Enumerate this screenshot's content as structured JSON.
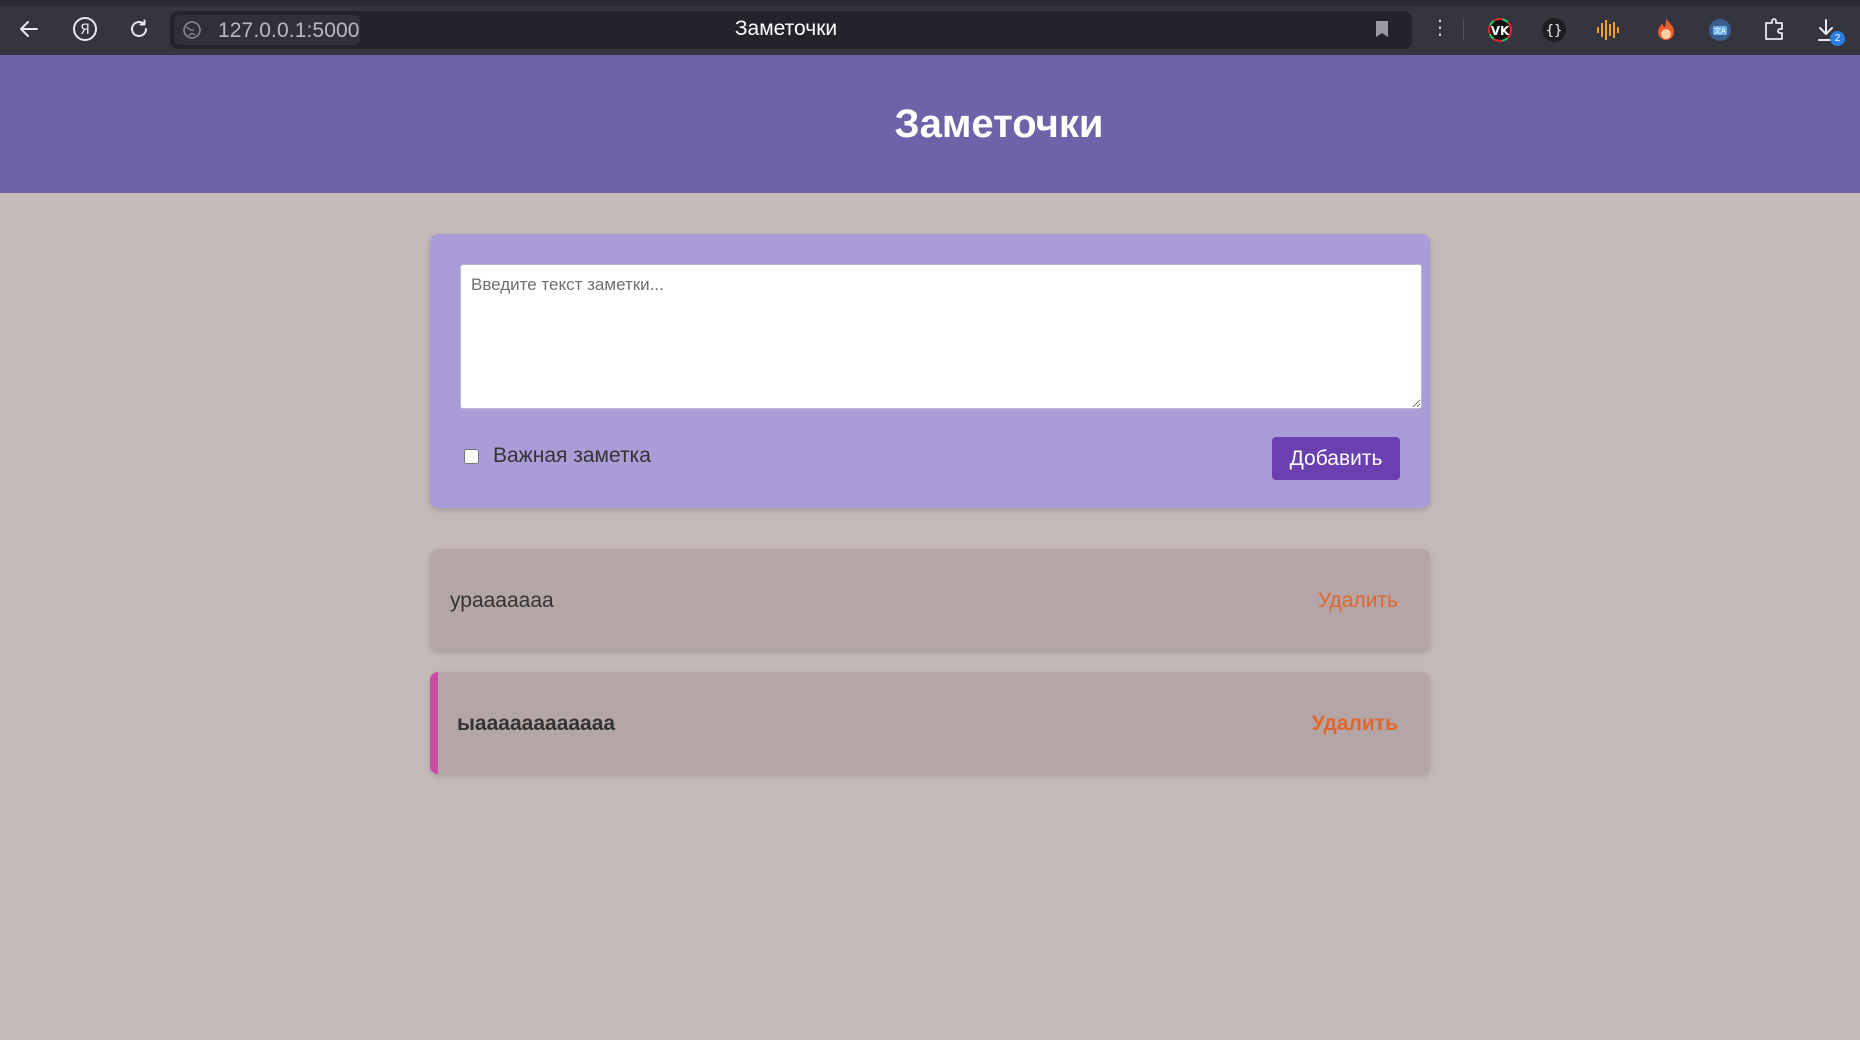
{
  "browser": {
    "url": "127.0.0.1:5000",
    "tab_title": "Заметочки",
    "downloads_badge": "2"
  },
  "header": {
    "title": "Заметочки"
  },
  "form": {
    "placeholder": "Введите текст заметки...",
    "important_label": "Важная заметка",
    "important_checked": false,
    "add_label": "Добавить"
  },
  "notes": [
    {
      "text": "урааааааа",
      "important": false,
      "delete_label": "Удалить"
    },
    {
      "text": "ыаааааааааааа",
      "important": true,
      "delete_label": "Удалить"
    }
  ],
  "colors": {
    "header_bg": "#6e62a8",
    "page_bg": "#c5b9b9",
    "form_bg": "#aa9dd7",
    "note_bg": "#b4a6a6",
    "button_bg": "#6a3fb0",
    "delete_color": "#e0662e",
    "important_accent": "#c94ca8"
  }
}
